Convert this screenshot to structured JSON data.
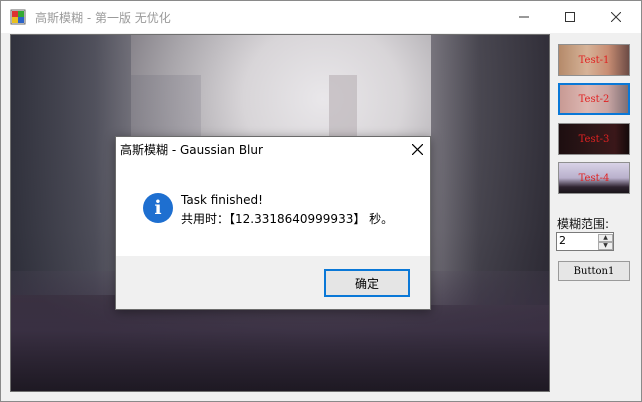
{
  "window": {
    "title": "高斯模糊 - 第一版 无优化"
  },
  "thumbnails": [
    {
      "label": "Test-1"
    },
    {
      "label": "Test-2"
    },
    {
      "label": "Test-3"
    },
    {
      "label": "Test-4"
    }
  ],
  "controls": {
    "blur_label": "模糊范围:",
    "blur_value": "2",
    "button1_label": "Button1"
  },
  "dialog": {
    "title": "高斯模糊 - Gaussian Blur",
    "message_line1": "Task finished!",
    "message_line2": "共用时：【12.3318640999933】 秒。",
    "ok_label": "确定"
  },
  "colors": {
    "accent": "#0a78d7",
    "info_icon": "#1e6fd0",
    "thumbnail_text": "#e02222"
  }
}
